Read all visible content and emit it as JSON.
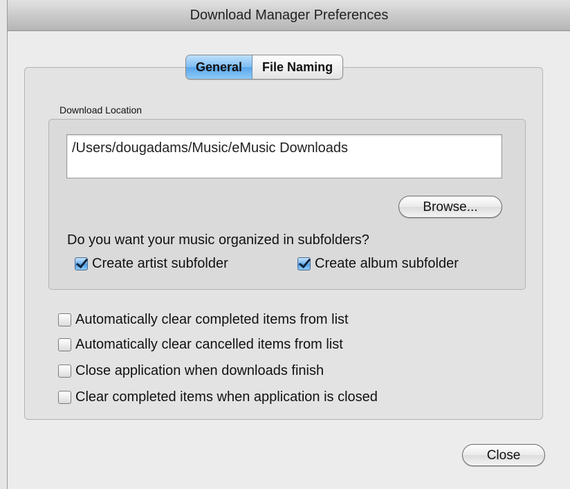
{
  "window": {
    "title": "Download Manager Preferences"
  },
  "tabs": [
    {
      "label": "General",
      "active": true
    },
    {
      "label": "File Naming",
      "active": false
    }
  ],
  "download_location": {
    "label": "Download Location",
    "path": "/Users/dougadams/Music/eMusic Downloads",
    "browse_label": "Browse..."
  },
  "subfolders": {
    "question": "Do you want your music organized in subfolders?",
    "artist": {
      "label": "Create artist subfolder",
      "checked": true
    },
    "album": {
      "label": "Create album subfolder",
      "checked": true
    }
  },
  "options": [
    {
      "label": "Automatically clear completed items from list",
      "checked": false
    },
    {
      "label": "Automatically clear cancelled items from list",
      "checked": false
    },
    {
      "label": "Close application when downloads finish",
      "checked": false
    },
    {
      "label": "Clear completed items when application is closed",
      "checked": false
    }
  ],
  "footer": {
    "close_label": "Close"
  },
  "colors": {
    "accent": "#5aa6ea",
    "window_bg": "#ececec"
  }
}
